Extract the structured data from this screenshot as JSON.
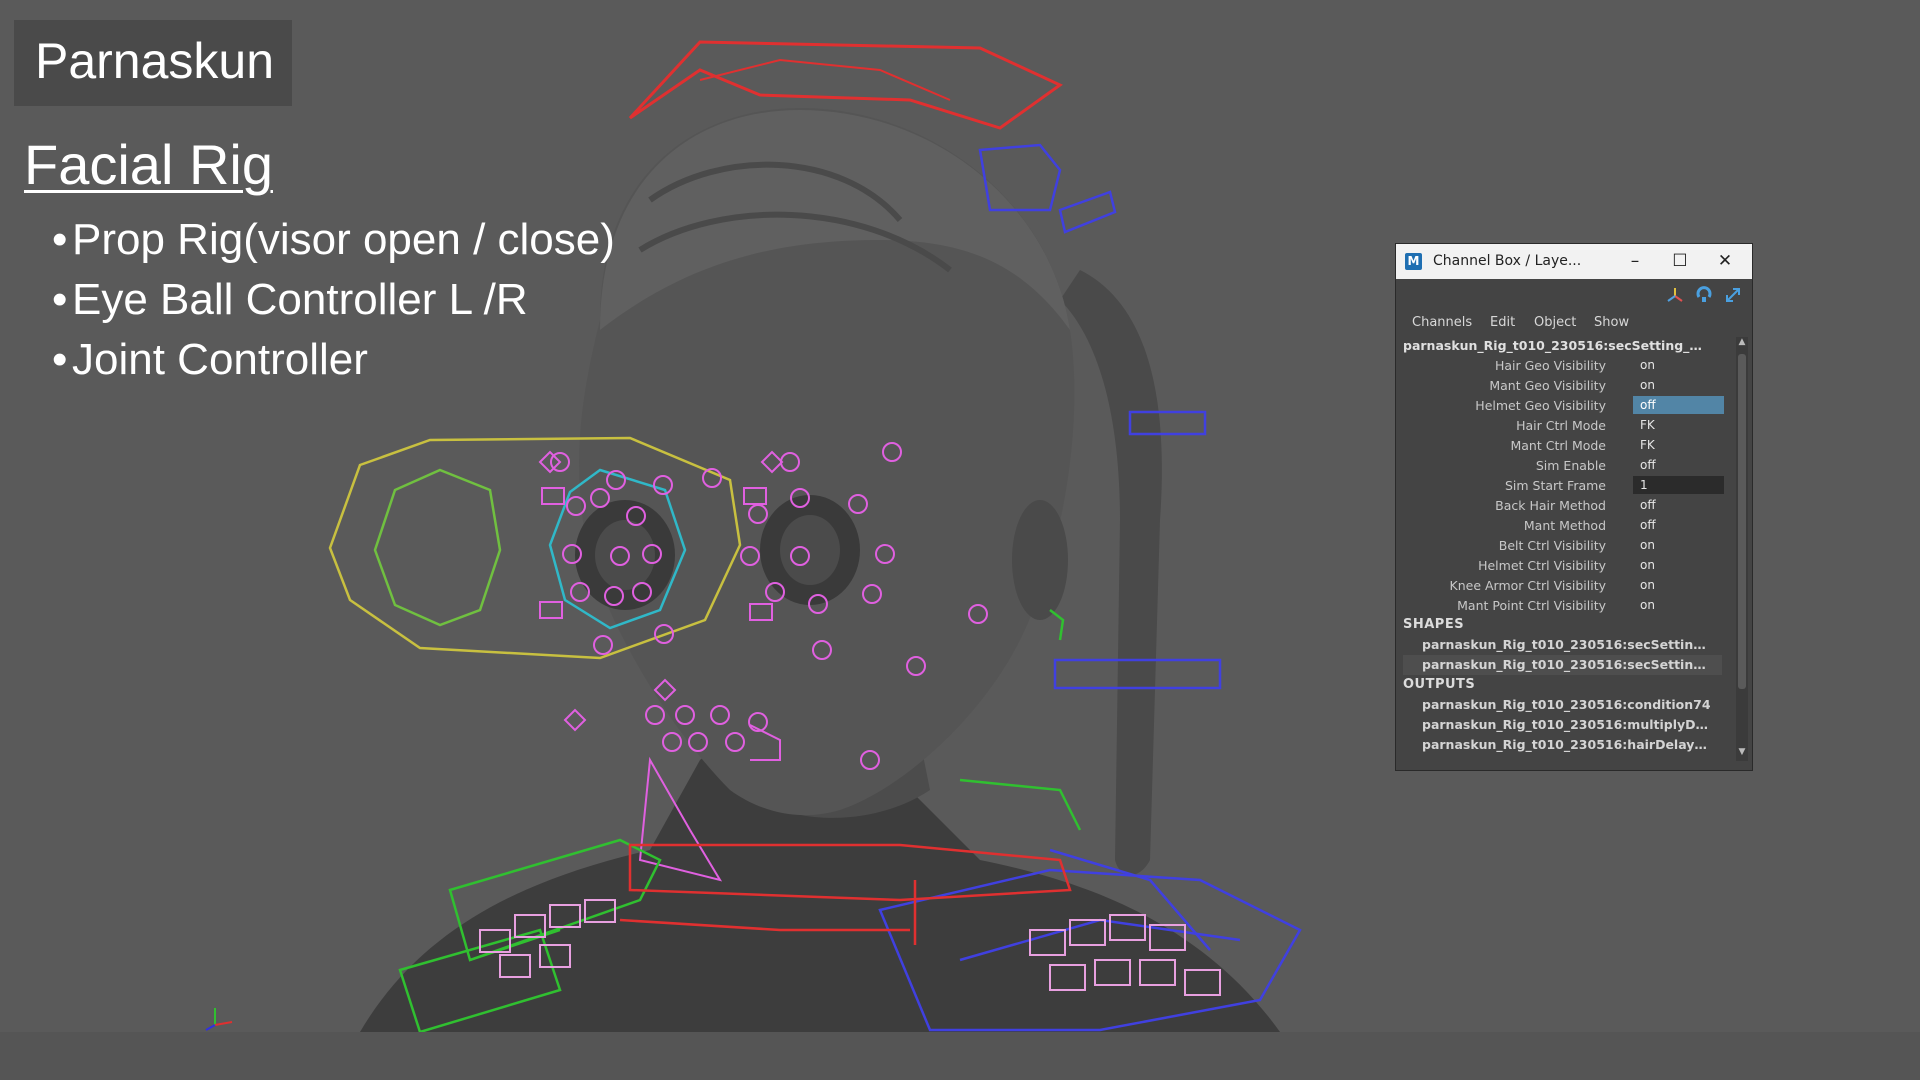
{
  "slide": {
    "title": "Parnaskun",
    "subtitle": "Facial Rig",
    "bullets": [
      "Prop Rig(visor open / close)",
      "Eye Ball Controller L /R",
      "Joint Controller"
    ]
  },
  "channel_box": {
    "window_title": "Channel Box / Laye...",
    "app_icon": "M",
    "window_buttons": {
      "minimize": "–",
      "maximize": "☐",
      "close": "✕"
    },
    "toolbar_icons": [
      "axis-icon",
      "refresh-icon",
      "expand-icon"
    ],
    "menu": [
      "Channels",
      "Edit",
      "Object",
      "Show"
    ],
    "node_name": "parnaskun_Rig_t010_230516:secSetting_…",
    "attributes": [
      {
        "label": "Hair Geo Visibility",
        "value": "on"
      },
      {
        "label": "Mant Geo Visibility",
        "value": "on"
      },
      {
        "label": "Helmet Geo Visibility",
        "value": "off",
        "selected": true
      },
      {
        "label": "Hair Ctrl Mode",
        "value": "FK"
      },
      {
        "label": "Mant Ctrl Mode",
        "value": "FK"
      },
      {
        "label": "Sim Enable",
        "value": "off"
      },
      {
        "label": "Sim Start Frame",
        "value": "1",
        "field": true
      },
      {
        "label": "Back Hair Method",
        "value": "off"
      },
      {
        "label": "Mant Method",
        "value": "off"
      },
      {
        "label": "Belt Ctrl Visibility",
        "value": "on"
      },
      {
        "label": "Helmet Ctrl Visibility",
        "value": "on"
      },
      {
        "label": "Knee Armor Ctrl Visibility",
        "value": "on"
      },
      {
        "label": "Mant Point Ctrl Visibility",
        "value": "on"
      }
    ],
    "shapes_header": "SHAPES",
    "shapes": [
      "parnaskun_Rig_t010_230516:secSettin…",
      "parnaskun_Rig_t010_230516:secSettin…"
    ],
    "outputs_header": "OUTPUTS",
    "outputs": [
      "parnaskun_Rig_t010_230516:condition74",
      "parnaskun_Rig_t010_230516:multiplyD…",
      "parnaskun_Rig_t010_230516:hairDelay…"
    ],
    "accent_color": "#5285a6"
  },
  "viewport": {
    "controller_colors": {
      "eye_target": "#c8c040",
      "eye_inner": "#70c040",
      "eyeball": "#30b8c8",
      "face_ctrl": "#e060e0",
      "head_ctrl": "#e03030",
      "body_left": "#30c030",
      "body_right": "#3030e0",
      "neck_ctrl": "#e03030"
    }
  }
}
